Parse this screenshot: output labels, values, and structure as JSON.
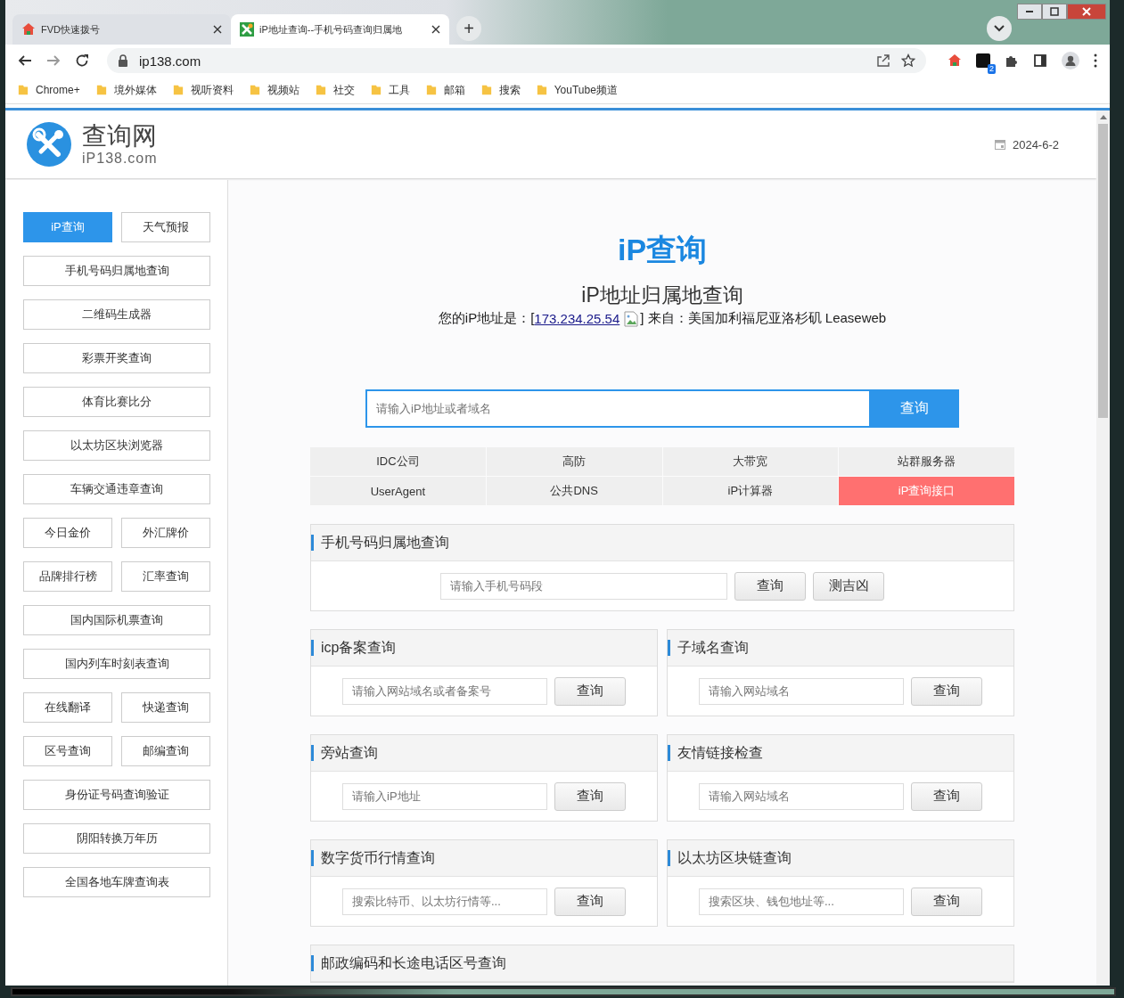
{
  "browser": {
    "tabs": [
      {
        "title": "FVD快速拨号",
        "selected": false
      },
      {
        "title": "iP地址查询--手机号码查询归属地",
        "selected": true
      }
    ],
    "new_tab": "+",
    "address": "ip138.com",
    "extension_badge": "2",
    "bookmarks": [
      "Chrome+",
      "境外媒体",
      "视听资料",
      "视频站",
      "社交",
      "工具",
      "邮箱",
      "搜索",
      "YouTube频道"
    ]
  },
  "header": {
    "logo_title": "查询网",
    "logo_subtitle": "iP138.com",
    "date": "2024-6-2"
  },
  "sidebar": {
    "rows": [
      [
        {
          "label": "iP查询",
          "selected": true
        },
        {
          "label": "天气预报",
          "selected": false
        }
      ],
      [
        {
          "label": "手机号码归属地查询",
          "selected": false
        }
      ],
      [
        {
          "label": "二维码生成器",
          "selected": false
        }
      ],
      [
        {
          "label": "彩票开奖查询",
          "selected": false
        }
      ],
      [
        {
          "label": "体育比赛比分",
          "selected": false
        }
      ],
      [
        {
          "label": "以太坊区块浏览器",
          "selected": false
        }
      ],
      [
        {
          "label": "车辆交通违章查询",
          "selected": false
        }
      ],
      [
        {
          "label": "今日金价",
          "selected": false
        },
        {
          "label": "外汇牌价",
          "selected": false
        }
      ],
      [
        {
          "label": "品牌排行榜",
          "selected": false
        },
        {
          "label": "汇率查询",
          "selected": false
        }
      ],
      [
        {
          "label": "国内国际机票查询",
          "selected": false
        }
      ],
      [
        {
          "label": "国内列车时刻表查询",
          "selected": false
        }
      ],
      [
        {
          "label": "在线翻译",
          "selected": false
        },
        {
          "label": "快递查询",
          "selected": false
        }
      ],
      [
        {
          "label": "区号查询",
          "selected": false
        },
        {
          "label": "邮编查询",
          "selected": false
        }
      ],
      [
        {
          "label": "身份证号码查询验证",
          "selected": false
        }
      ],
      [
        {
          "label": "阴阳转换万年历",
          "selected": false
        }
      ],
      [
        {
          "label": "全国各地车牌查询表",
          "selected": false
        }
      ]
    ]
  },
  "main": {
    "title": "iP查询",
    "subtitle": "iP地址归属地查询",
    "ip_line": {
      "prefix": "您的iP地址是：[",
      "ip": "173.234.25.54",
      "suffix": "] 来自：美国加利福尼亚洛杉矶 Leaseweb"
    },
    "search": {
      "placeholder": "请输入iP地址或者域名",
      "button": "查询"
    },
    "links": [
      {
        "label": "IDC公司",
        "highlighted": false
      },
      {
        "label": "高防",
        "highlighted": false
      },
      {
        "label": "大带宽",
        "highlighted": false
      },
      {
        "label": "站群服务器",
        "highlighted": false
      },
      {
        "label": "UserAgent",
        "highlighted": false
      },
      {
        "label": "公共DNS",
        "highlighted": false
      },
      {
        "label": "iP计算器",
        "highlighted": false
      },
      {
        "label": "iP查询接口",
        "highlighted": true
      }
    ],
    "cards": [
      {
        "title": "手机号码归属地查询",
        "wide": true,
        "placeholder": "请输入手机号码段",
        "buttons": [
          "查询",
          "测吉凶"
        ]
      },
      {
        "title": "icp备案查询",
        "wide": false,
        "placeholder": "请输入网站域名或者备案号",
        "buttons": [
          "查询"
        ]
      },
      {
        "title": "子域名查询",
        "wide": false,
        "placeholder": "请输入网站域名",
        "buttons": [
          "查询"
        ]
      },
      {
        "title": "旁站查询",
        "wide": false,
        "placeholder": "请输入iP地址",
        "buttons": [
          "查询"
        ]
      },
      {
        "title": "友情链接检查",
        "wide": false,
        "placeholder": "请输入网站域名",
        "buttons": [
          "查询"
        ]
      },
      {
        "title": "数字货币行情查询",
        "wide": false,
        "placeholder": "搜索比特币、以太坊行情等...",
        "buttons": [
          "查询"
        ]
      },
      {
        "title": "以太坊区块链查询",
        "wide": false,
        "placeholder": "搜索区块、钱包地址等...",
        "buttons": [
          "查询"
        ]
      },
      {
        "title": "邮政编码和长途电话区号查询",
        "wide": true
      }
    ]
  }
}
